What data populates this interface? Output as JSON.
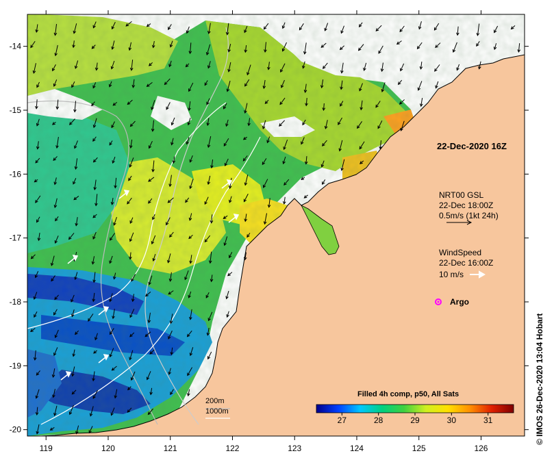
{
  "map": {
    "lon_min": 118.7,
    "lon_max": 126.7,
    "lat_min": -20.1,
    "lat_max": -13.5,
    "lon_ticks": [
      119,
      120,
      121,
      122,
      123,
      124,
      125,
      126
    ],
    "lat_ticks": [
      -14,
      -15,
      -16,
      -17,
      -18,
      -19,
      -20
    ],
    "land_color": "#f7c69d",
    "coast_color": "#000000"
  },
  "labels": {
    "date": "22-Dec-2020 16Z",
    "current_title": "NRT00 GSL",
    "current_time": "22-Dec 18:00Z",
    "current_scale": "0.5m/s (1kt 24h)",
    "wind_title": "WindSpeed",
    "wind_time": "22-Dec 16:00Z",
    "wind_scale": "10 m/s",
    "argo": "Argo",
    "contour_200": "200m",
    "contour_1000": "1000m",
    "colorbar_title": "Filled 4h comp, p50, All Sats",
    "credit": "© IMOS 26-Dec-2020 13:04 Hobart"
  },
  "colorbar": {
    "ticks": [
      27,
      28,
      29,
      30,
      31
    ],
    "min": 26.3,
    "max": 31.7,
    "stops": [
      "#00008c",
      "#0040ff",
      "#00c8ff",
      "#00d080",
      "#40d040",
      "#d0f020",
      "#ffe000",
      "#ff9000",
      "#e02000",
      "#800000"
    ]
  },
  "colors": {
    "argo": "#ff00ff",
    "wind_arrow": "#ffffff",
    "current_arrow": "#000000"
  }
}
